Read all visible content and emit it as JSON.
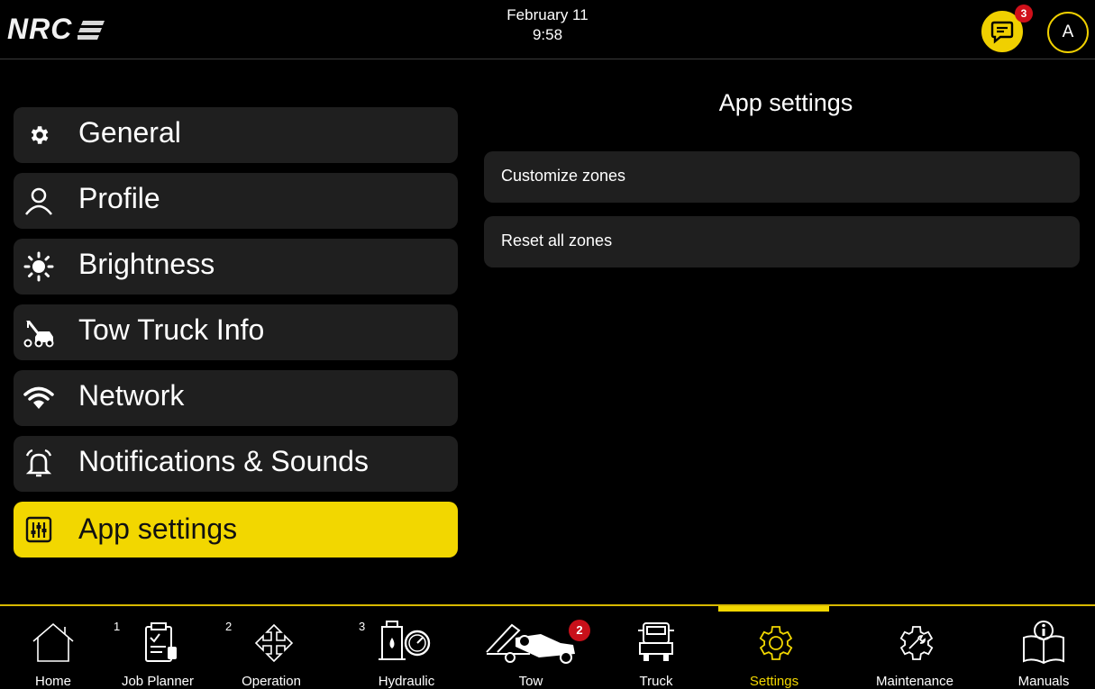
{
  "header": {
    "logo_text": "NRC",
    "date": "February 11",
    "time": "9:58",
    "messages_badge": "3",
    "avatar_initial": "A"
  },
  "menu": {
    "items": [
      {
        "label": "General",
        "icon": "gear-icon"
      },
      {
        "label": "Profile",
        "icon": "user-icon"
      },
      {
        "label": "Brightness",
        "icon": "sun-icon"
      },
      {
        "label": "Tow Truck Info",
        "icon": "tow-truck-icon"
      },
      {
        "label": "Network",
        "icon": "wifi-icon"
      },
      {
        "label": "Notifications & Sounds",
        "icon": "bell-icon"
      },
      {
        "label": "App settings",
        "icon": "sliders-icon",
        "active": true
      }
    ]
  },
  "panel": {
    "title": "App settings",
    "rows": [
      "Customize zones",
      "Reset all zones"
    ]
  },
  "bottom_nav": {
    "items": [
      {
        "label": "Home",
        "icon": "home-icon"
      },
      {
        "label": "Job Planner",
        "icon": "clipboard-icon",
        "number": "1"
      },
      {
        "label": "Operation",
        "icon": "move-arrows-icon",
        "number": "2"
      },
      {
        "label": "Hydraulic",
        "icon": "hydraulic-gauge-icon",
        "number": "3"
      },
      {
        "label": "Tow",
        "icon": "tow-icon",
        "badge": "2"
      },
      {
        "label": "Truck",
        "icon": "truck-front-icon"
      },
      {
        "label": "Settings",
        "icon": "settings-gear-icon",
        "active": true
      },
      {
        "label": "Maintenance",
        "icon": "wrench-gear-icon"
      },
      {
        "label": "Manuals",
        "icon": "manual-book-icon"
      }
    ]
  },
  "colors": {
    "accent": "#f2d700",
    "badge": "#d0101a",
    "panel_bg": "#1f1f1f",
    "background": "#000000"
  }
}
